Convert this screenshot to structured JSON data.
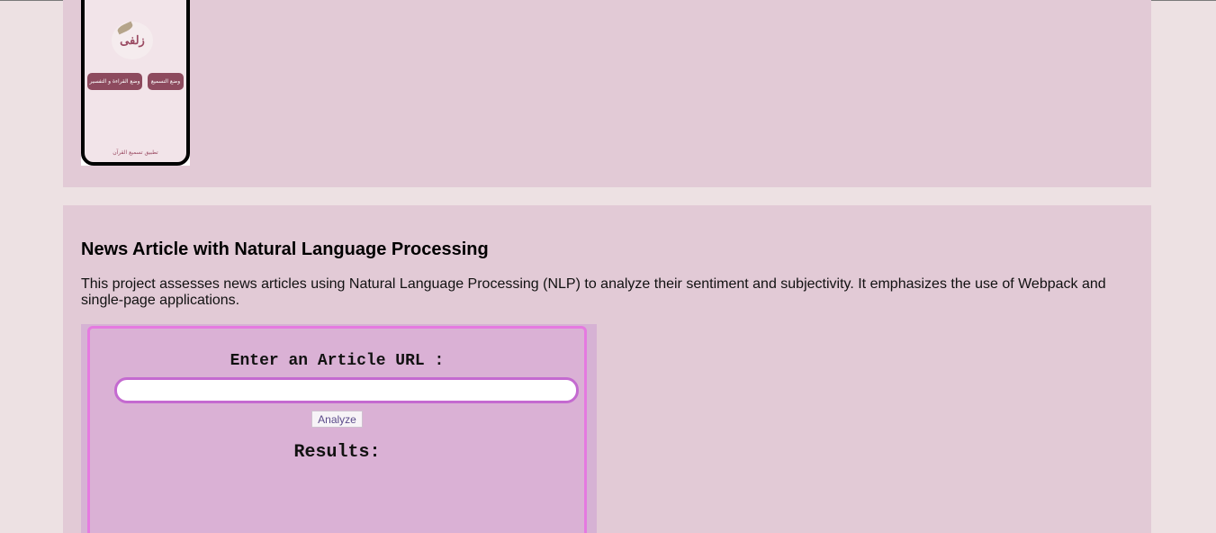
{
  "project_top": {
    "phone_screenshot": {
      "logo_text": "زلفى",
      "button_left": "وضع القراءة و التفسير",
      "button_right": "وضع التسميع",
      "footer": "تطبيق تسميع القرآن"
    }
  },
  "project_nlp": {
    "title": "News Article with Natural Language Processing",
    "description": "This project assesses news articles using Natural Language Processing (NLP) to analyze their sentiment and subjectivity. It emphasizes the use of Webpack and single-page applications.",
    "app_screenshot": {
      "url_label": "Enter an Article URL :",
      "url_value": "",
      "analyze_label": "Analyze",
      "results_label": "Results:"
    }
  },
  "colors": {
    "page_bg": "#ede1e3",
    "card_bg": "#e2cad6",
    "app_panel_bg": "#dab1d5",
    "app_panel_border": "#e57ae0",
    "phone_button": "#8d4a5e"
  }
}
